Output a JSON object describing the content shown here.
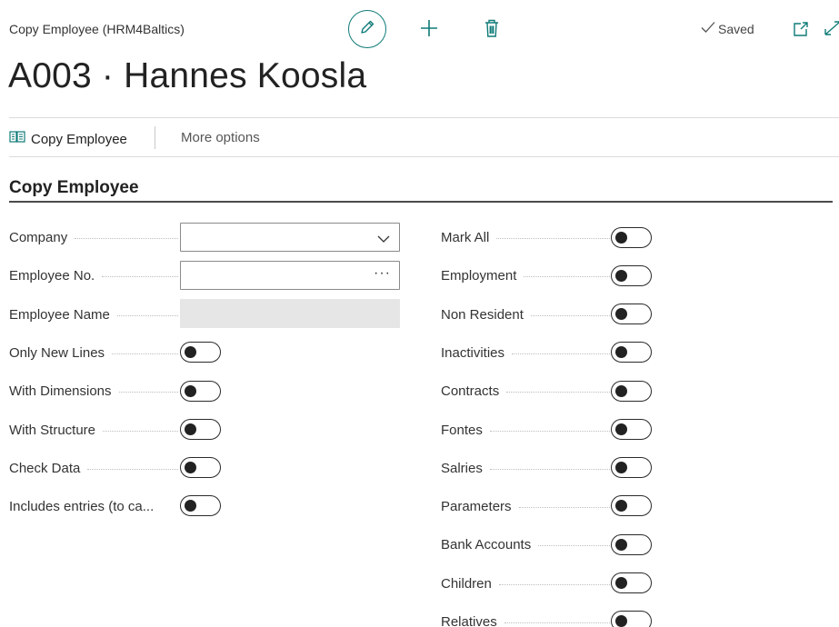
{
  "header": {
    "window_title": "Copy Employee (HRM4Baltics)",
    "saved_label": "Saved",
    "page_title": "A003 · Hannes Koosla"
  },
  "actions": {
    "copy_employee": "Copy Employee",
    "more_options": "More options"
  },
  "section": {
    "title": "Copy Employee"
  },
  "left_fields": [
    {
      "label": "Company",
      "value": ""
    },
    {
      "label": "Employee No.",
      "value": ""
    },
    {
      "label": "Employee Name",
      "value": ""
    },
    {
      "label": "Only New Lines",
      "value": "off"
    },
    {
      "label": "With Dimensions",
      "value": "off"
    },
    {
      "label": "With Structure",
      "value": "off"
    },
    {
      "label": "Check Data",
      "value": "off"
    },
    {
      "label": "Includes entries (to ca...",
      "value": "off"
    }
  ],
  "right_fields": [
    {
      "label": "Mark All",
      "value": "off"
    },
    {
      "label": "Employment",
      "value": "off"
    },
    {
      "label": "Non Resident",
      "value": "off"
    },
    {
      "label": "Inactivities",
      "value": "off"
    },
    {
      "label": "Contracts",
      "value": "off"
    },
    {
      "label": "Fontes",
      "value": "off"
    },
    {
      "label": "Salries",
      "value": "off"
    },
    {
      "label": "Parameters",
      "value": "off"
    },
    {
      "label": "Bank Accounts",
      "value": "off"
    },
    {
      "label": "Children",
      "value": "off"
    },
    {
      "label": "Relatives",
      "value": "off"
    }
  ],
  "colors": {
    "accent": "#0f7b78",
    "toggle_border": "#2a2a2a",
    "readonly_bg": "#e6e6e7"
  },
  "icons": [
    "pencil-icon",
    "plus-icon",
    "trash-icon",
    "checkmark-icon",
    "open-in-new-window-icon",
    "expand-icon",
    "copy-document-icon",
    "chevron-down-icon",
    "ellipsis-icon"
  ]
}
